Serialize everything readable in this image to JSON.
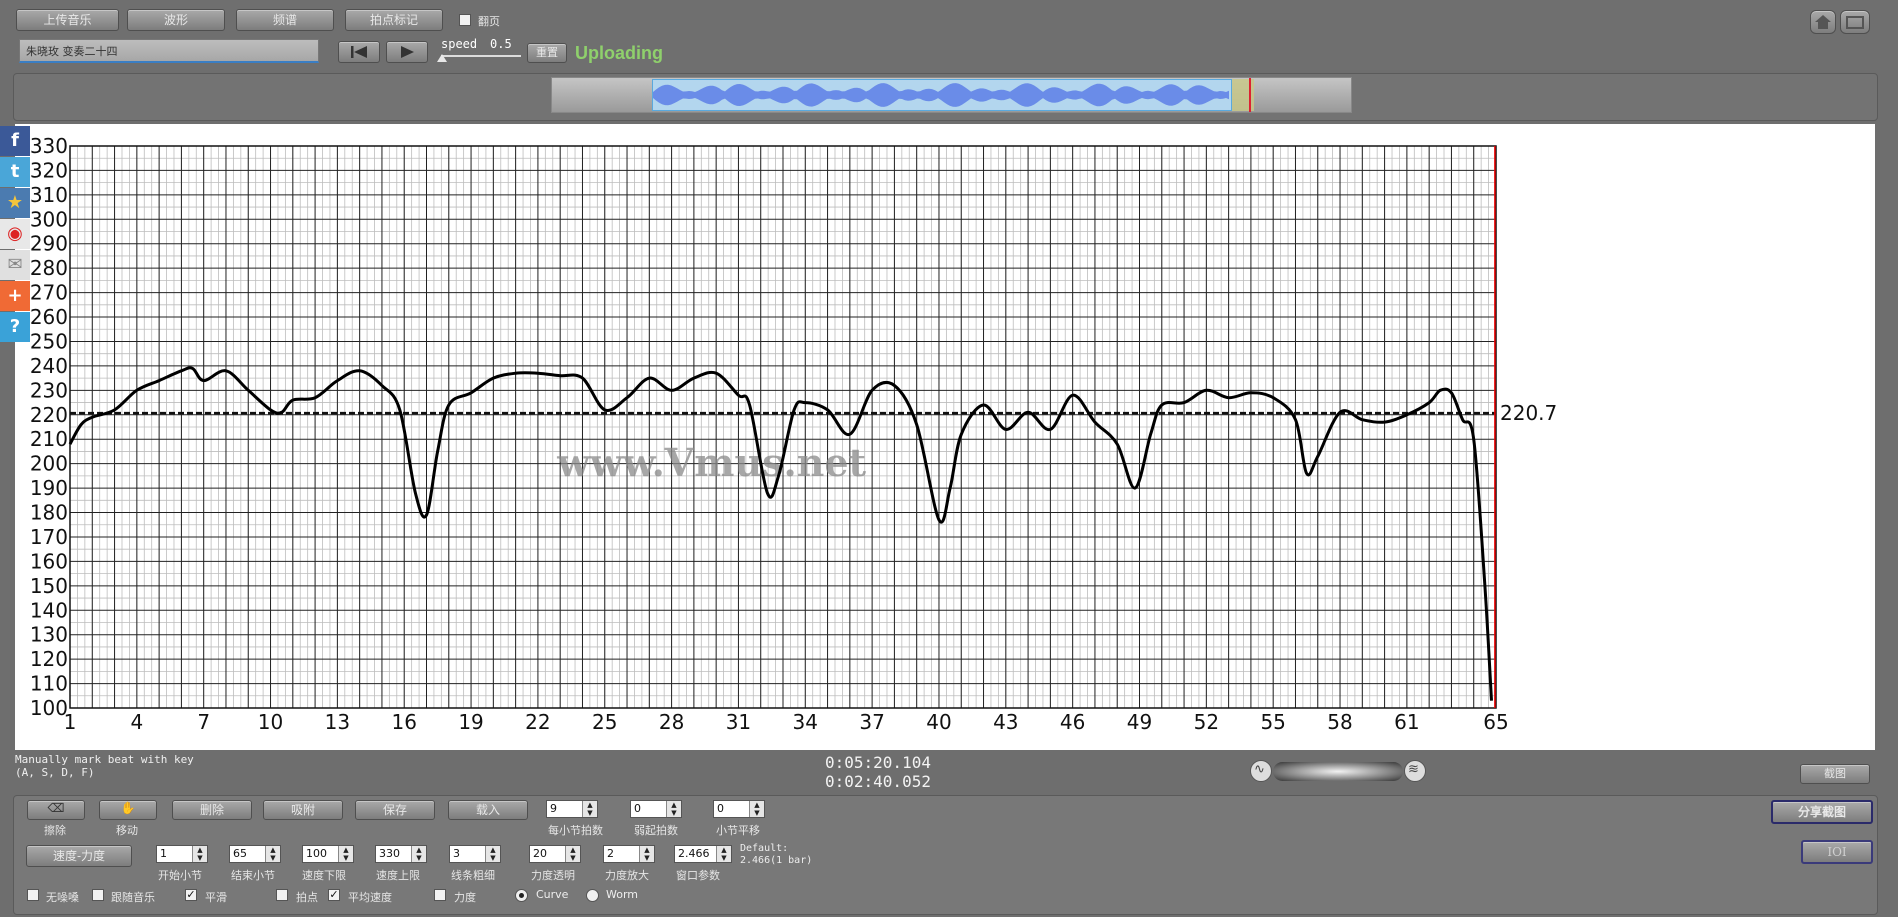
{
  "toolbar": {
    "upload_music": "上传音乐",
    "waveform": "波形",
    "spectrum": "频谱",
    "beat_mark": "拍点标记",
    "follow_page": "翻页",
    "track_name": "朱晓玫 变奏二十四",
    "speed_label": "speed",
    "speed_value": "0.5",
    "reset": "重置",
    "status": "Uploading"
  },
  "chart_data": {
    "type": "line",
    "ylim": [
      100,
      330
    ],
    "yticks": [
      "330",
      "320",
      "310",
      "300",
      "290",
      "280",
      "270",
      "260",
      "250",
      "240",
      "230",
      "220",
      "210",
      "200",
      "190",
      "180",
      "170",
      "160",
      "150",
      "140",
      "130",
      "120",
      "110",
      "100"
    ],
    "xlim": [
      1,
      65
    ],
    "xticks": [
      "1",
      "4",
      "7",
      "10",
      "13",
      "16",
      "19",
      "22",
      "25",
      "28",
      "31",
      "34",
      "37",
      "40",
      "43",
      "46",
      "49",
      "52",
      "55",
      "58",
      "61",
      "65"
    ],
    "average": 220.7,
    "average_label": "220.7",
    "watermark": "www.Vmus.net",
    "x": [
      1,
      1.5,
      2,
      3,
      4,
      5,
      6,
      6.5,
      7,
      8,
      9,
      10,
      10.5,
      11,
      12,
      13,
      14,
      15,
      15.8,
      16.5,
      17,
      17.5,
      18,
      19,
      20,
      21,
      22,
      23,
      24,
      25,
      26,
      27,
      28,
      29,
      30,
      31,
      31.5,
      32.3,
      32.8,
      33.5,
      34,
      35,
      36,
      37,
      38,
      39,
      40,
      40.5,
      41,
      42,
      43,
      44,
      45,
      46,
      47,
      48,
      48.8,
      49.5,
      50,
      51,
      52,
      53,
      54,
      55,
      56,
      56.5,
      57,
      58,
      59,
      60,
      61,
      62,
      62.5,
      63,
      63.5,
      64,
      64.5,
      64.8
    ],
    "values": [
      208,
      216,
      219,
      222,
      230,
      234,
      238,
      239,
      234,
      238,
      230,
      222,
      221,
      226,
      227,
      234,
      238,
      232,
      222,
      188,
      179,
      205,
      224,
      229,
      235,
      237,
      237,
      236,
      235,
      222,
      227,
      235,
      230,
      235,
      237,
      228,
      224,
      188,
      195,
      222,
      225,
      222,
      212,
      230,
      232,
      216,
      177,
      190,
      212,
      224,
      214,
      221,
      214,
      228,
      217,
      208,
      190,
      212,
      224,
      225,
      230,
      227,
      229,
      227,
      218,
      196,
      203,
      221,
      218,
      217,
      220,
      225,
      230,
      229,
      218,
      210,
      150,
      103
    ]
  },
  "footer": {
    "hint_line1": "Manually mark beat with key",
    "hint_line2": "(A, S, D, F)",
    "time_total": "0:05:20.104",
    "time_current": "0:02:40.052",
    "screenshot": "截图",
    "share_screenshot": "分享截图",
    "ioi": "IOI"
  },
  "controls": {
    "erase_label": "擦除",
    "move_label": "移动",
    "delete": "删除",
    "snap": "吸附",
    "save": "保存",
    "load": "载入",
    "beats_per_bar": {
      "label": "每小节拍数",
      "value": "9"
    },
    "pickup_beats": {
      "label": "弱起拍数",
      "value": "0"
    },
    "bar_offset": {
      "label": "小节平移",
      "value": "0"
    },
    "tempo_dynamics": "速度-力度",
    "start_bar": {
      "label": "开始小节",
      "value": "1"
    },
    "end_bar": {
      "label": "结束小节",
      "value": "65"
    },
    "tempo_min": {
      "label": "速度下限",
      "value": "100"
    },
    "tempo_max": {
      "label": "速度上限",
      "value": "330"
    },
    "line_width": {
      "label": "线条粗细",
      "value": "3"
    },
    "dyn_transparency": {
      "label": "力度透明",
      "value": "20"
    },
    "dyn_scale": {
      "label": "力度放大",
      "value": "2"
    },
    "window_param": {
      "label": "窗口参数",
      "value": "2.466"
    },
    "default_line1": "Default:",
    "default_line2": "2.466(1 bar)",
    "no_bgm": "无噪嗓",
    "follow_music": "跟随音乐",
    "smooth": "平滑",
    "beat_point": "拍点",
    "avg_tempo": "平均速度",
    "dynamics": "力度",
    "curve": "Curve",
    "worm": "Worm"
  }
}
